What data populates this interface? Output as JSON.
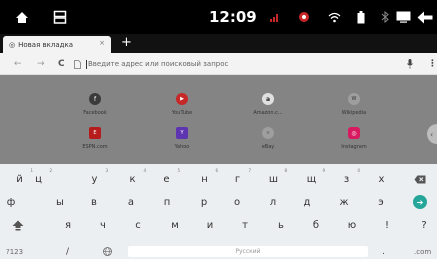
{
  "status_bar": {
    "time": "12:09",
    "icons": [
      "home-icon",
      "recents-icon",
      "signal-icon",
      "vpn-icon",
      "wifi-icon",
      "battery-icon",
      "bluetooth-icon",
      "screen-icon",
      "back-arrow-icon"
    ]
  },
  "browser": {
    "tab_title": "Новая вкладка",
    "tab_close": "×",
    "new_tab": "+",
    "omnibox_placeholder": "Введите адрес или поисковый запрос",
    "accent": "#26a69a"
  },
  "ntp": {
    "tiles": [
      {
        "label": "Facebook",
        "icon": "f",
        "color": "#3b3b3b"
      },
      {
        "label": "YouTube",
        "icon": "▶",
        "color": "#c62828"
      },
      {
        "label": "Amazon.c...",
        "icon": "a",
        "color": "#e0e0e0"
      },
      {
        "label": "Wikipedia",
        "icon": "W",
        "color": "#9e9e9e"
      },
      {
        "label": "ESPN.com",
        "icon": "E",
        "color": "#b71c1c"
      },
      {
        "label": "Yahoo",
        "icon": "Y",
        "color": "#5e35b1"
      },
      {
        "label": "eBay",
        "icon": "e",
        "color": "#9e9e9e"
      },
      {
        "label": "Instagram",
        "icon": "◎",
        "color": "#d81b60"
      }
    ]
  },
  "keyboard": {
    "row1": [
      {
        "k": "й",
        "h": "1"
      },
      {
        "k": "ц",
        "h": "2"
      },
      {
        "k": "у",
        "h": "3"
      },
      {
        "k": "к",
        "h": "4"
      },
      {
        "k": "е",
        "h": "5"
      },
      {
        "k": "н",
        "h": "6"
      },
      {
        "k": "г",
        "h": "7"
      },
      {
        "k": "ш",
        "h": "8"
      },
      {
        "k": "щ",
        "h": "9"
      },
      {
        "k": "з",
        "h": "0"
      },
      {
        "k": "х",
        "h": ""
      }
    ],
    "row2": [
      "ф",
      "ы",
      "в",
      "а",
      "п",
      "р",
      "о",
      "л",
      "д",
      "ж",
      "э"
    ],
    "row3": [
      "я",
      "ч",
      "с",
      "м",
      "и",
      "т",
      "ь",
      "б",
      "ю",
      "!",
      "?"
    ],
    "sym": "?123",
    "slash": "/",
    "space": "Русский",
    "dot": ".",
    "com": ".com"
  }
}
